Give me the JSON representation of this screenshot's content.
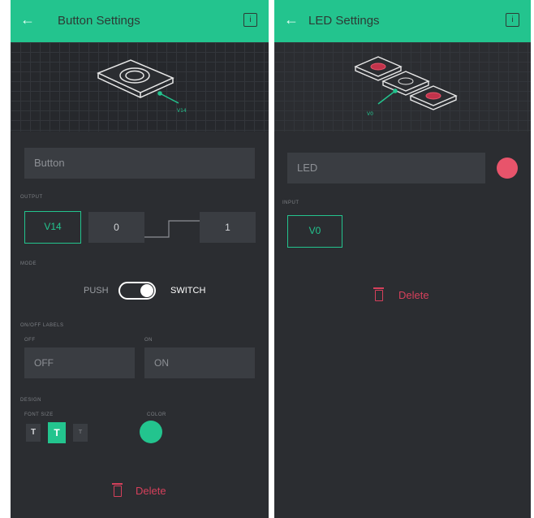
{
  "button_settings": {
    "title": "Button Settings",
    "name_value": "Button",
    "output_label": "OUTPUT",
    "pin": "V14",
    "value_min": "0",
    "value_max": "1",
    "mode_label": "MODE",
    "mode_push": "PUSH",
    "mode_switch": "SWITCH",
    "mode_selected": "SWITCH",
    "on_off_label": "ON/OFF LABELS",
    "off_label_caption": "OFF",
    "on_label_caption": "ON",
    "off_value": "OFF",
    "on_value": "ON",
    "design_label": "DESIGN",
    "font_size_label": "FONT SIZE",
    "font_sizes": [
      "T",
      "T",
      "T"
    ],
    "font_size_selected_index": 1,
    "color_label": "COLOR",
    "color": "#23c48e",
    "delete_label": "Delete"
  },
  "led_settings": {
    "title": "LED Settings",
    "name_value": "LED",
    "color": "#e8546b",
    "input_label": "INPUT",
    "pin": "V0",
    "delete_label": "Delete"
  },
  "colors": {
    "accent": "#23c48e",
    "background": "#2b2d31",
    "delete": "#d6405b"
  }
}
